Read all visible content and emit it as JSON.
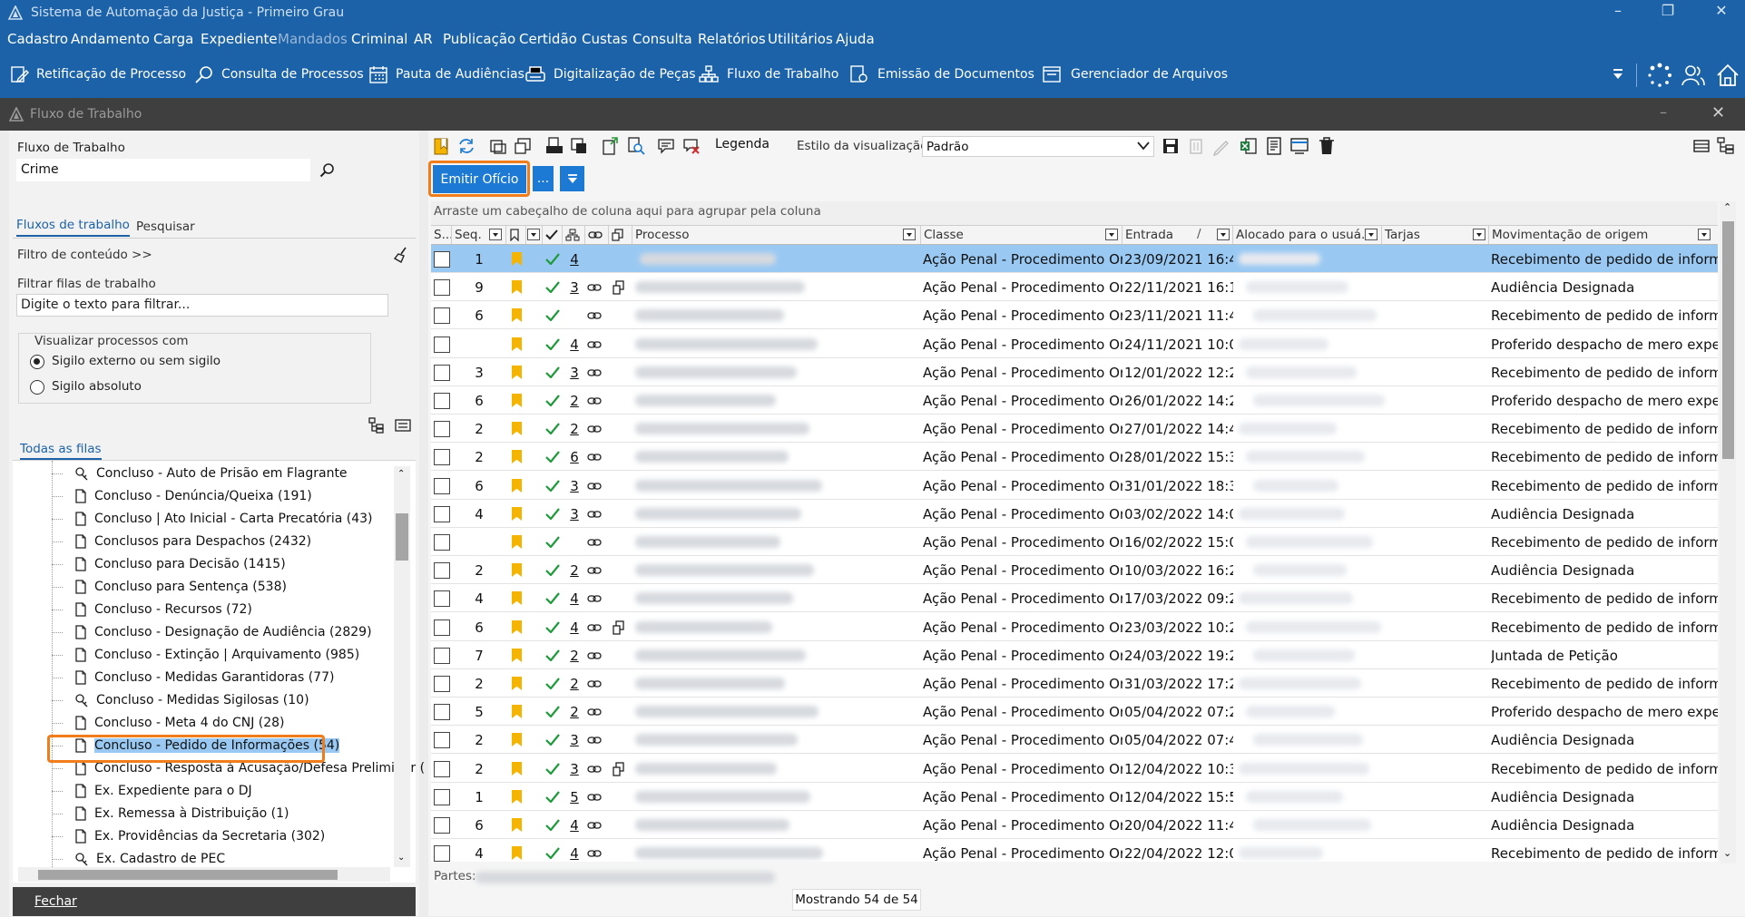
{
  "window": {
    "title": "Sistema de Automação da Justiça - Primeiro Grau"
  },
  "menu": [
    "Cadastro",
    "Andamento",
    "Carga",
    "Expediente",
    "Mandados",
    "Criminal",
    "AR",
    "Publicação",
    "Certidão",
    "Custas",
    "Consulta",
    "Relatórios",
    "Utilitários",
    "Ajuda"
  ],
  "toolbar": [
    "Retificação de Processo",
    "Consulta de Processos",
    "Pauta de Audiências",
    "Digitalização de Peças",
    "Fluxo de Trabalho",
    "Emissão de Documentos",
    "Gerenciador de Arquivos"
  ],
  "inner_window": {
    "title": "Fluxo de Trabalho"
  },
  "left": {
    "workflow_label": "Fluxo de Trabalho",
    "workflow_value": "Crime",
    "tabs": [
      "Fluxos de trabalho",
      "Pesquisar"
    ],
    "content_filter": "Filtro de conteúdo >>",
    "filter_queues_label": "Filtrar filas de trabalho",
    "filter_queues_placeholder": "Digite o texto para filtrar...",
    "view_group": "Visualizar processos com",
    "radio1": "Sigilo externo ou sem sigilo",
    "radio2": "Sigilo absoluto",
    "all_queues": "Todas as filas",
    "queues": [
      "Concluso - Auto de Prisão em Flagrante",
      "Concluso - Denúncia/Queixa (191)",
      "Concluso | Ato Inicial - Carta Precatória (43)",
      "Conclusos para Despachos (2432)",
      "Concluso para Decisão (1415)",
      "Concluso para Sentença (538)",
      "Concluso - Recursos (72)",
      "Concluso - Designação de Audiência (2829)",
      "Concluso - Extinção | Arquivamento (985)",
      "Concluso - Medidas Garantidoras (77)",
      "Concluso - Medidas Sigilosas (10)",
      "Concluso - Meta 4 do CNJ (28)",
      "Concluso - Pedido de Informações (54)",
      "Concluso - Resposta à Acusação/Defesa Preliminar (",
      "Ex. Expediente para o DJ",
      "Ex. Remessa à Distribuição (1)",
      "Ex. Providências da Secretaria (302)",
      "Ex. Cadastro de PEC"
    ],
    "close_label": "Fechar"
  },
  "grid": {
    "legend_label": "Legenda",
    "style_label": "Estilo da visualização",
    "style_value": "Padrão",
    "emit_button": "Emitir Ofício",
    "more_button": "...",
    "group_hint": "Arraste um cabeçalho de coluna aqui para agrupar pela coluna",
    "columns": [
      "S...",
      "Seq.",
      "Processo",
      "Classe",
      "Entrada",
      "Alocado para o usuá...",
      "Tarjas",
      "Movimentação de origem"
    ],
    "rows": [
      {
        "seq": "1",
        "n": "4",
        "link": false,
        "doc": false,
        "classe": "Ação Penal - Procedimento Ordi",
        "entrada": "23/09/2021 16:4",
        "mov": "Recebimento de pedido de inform"
      },
      {
        "seq": "9",
        "n": "3",
        "link": true,
        "doc": true,
        "classe": "Ação Penal - Procedimento Ordi",
        "entrada": "22/11/2021 16:1",
        "mov": "Audiência Designada"
      },
      {
        "seq": "6",
        "n": "",
        "link": true,
        "doc": false,
        "classe": "Ação Penal - Procedimento Ordi",
        "entrada": "23/11/2021 11:4",
        "mov": "Recebimento de pedido de inform"
      },
      {
        "seq": "",
        "n": "4",
        "link": true,
        "doc": false,
        "classe": "Ação Penal - Procedimento Ordi",
        "entrada": "24/11/2021 10:0",
        "mov": "Proferido despacho de mero expe"
      },
      {
        "seq": "3",
        "n": "3",
        "link": true,
        "doc": false,
        "classe": "Ação Penal - Procedimento Ordi",
        "entrada": "12/01/2022 12:2",
        "mov": "Recebimento de pedido de inform"
      },
      {
        "seq": "6",
        "n": "2",
        "link": true,
        "doc": false,
        "classe": "Ação Penal - Procedimento Ordi",
        "entrada": "26/01/2022 14:2",
        "mov": "Proferido despacho de mero expe"
      },
      {
        "seq": "2",
        "n": "2",
        "link": true,
        "doc": false,
        "classe": "Ação Penal - Procedimento Ordi",
        "entrada": "27/01/2022 14:4",
        "mov": "Recebimento de pedido de inform"
      },
      {
        "seq": "2",
        "n": "6",
        "link": true,
        "doc": false,
        "classe": "Ação Penal - Procedimento Ordi",
        "entrada": "28/01/2022 15:3",
        "mov": "Recebimento de pedido de inform"
      },
      {
        "seq": "6",
        "n": "3",
        "link": true,
        "doc": false,
        "classe": "Ação Penal - Procedimento Ordi",
        "entrada": "31/01/2022 18:3",
        "mov": "Recebimento de pedido de inform"
      },
      {
        "seq": "4",
        "n": "3",
        "link": true,
        "doc": false,
        "classe": "Ação Penal - Procedimento Ordi",
        "entrada": "03/02/2022 14:0",
        "mov": "Audiência Designada"
      },
      {
        "seq": "",
        "n": "",
        "link": true,
        "doc": false,
        "classe": "Ação Penal - Procedimento Ordi",
        "entrada": "16/02/2022 15:0",
        "mov": "Recebimento de pedido de inform"
      },
      {
        "seq": "2",
        "n": "2",
        "link": true,
        "doc": false,
        "classe": "Ação Penal - Procedimento Ordi",
        "entrada": "10/03/2022 16:2",
        "mov": "Audiência Designada"
      },
      {
        "seq": "4",
        "n": "4",
        "link": true,
        "doc": false,
        "classe": "Ação Penal - Procedimento Ordi",
        "entrada": "17/03/2022 09:2",
        "mov": "Recebimento de pedido de inform"
      },
      {
        "seq": "6",
        "n": "4",
        "link": true,
        "doc": true,
        "classe": "Ação Penal - Procedimento Ordi",
        "entrada": "23/03/2022 10:2",
        "mov": "Recebimento de pedido de inform"
      },
      {
        "seq": "7",
        "n": "2",
        "link": true,
        "doc": false,
        "classe": "Ação Penal - Procedimento Ordi",
        "entrada": "24/03/2022 19:2",
        "mov": "Juntada de Petição"
      },
      {
        "seq": "2",
        "n": "2",
        "link": true,
        "doc": false,
        "classe": "Ação Penal - Procedimento Ordi",
        "entrada": "31/03/2022 17:2",
        "mov": "Recebimento de pedido de inform"
      },
      {
        "seq": "5",
        "n": "2",
        "link": true,
        "doc": false,
        "classe": "Ação Penal - Procedimento Ordi",
        "entrada": "05/04/2022 07:2",
        "mov": "Proferido despacho de mero expe"
      },
      {
        "seq": "2",
        "n": "3",
        "link": true,
        "doc": false,
        "classe": "Ação Penal - Procedimento Ordi",
        "entrada": "05/04/2022 07:4",
        "mov": "Audiência Designada"
      },
      {
        "seq": "2",
        "n": "3",
        "link": true,
        "doc": true,
        "classe": "Ação Penal - Procedimento Ordi",
        "entrada": "12/04/2022 10:3",
        "mov": "Recebimento de pedido de inform"
      },
      {
        "seq": "1",
        "n": "5",
        "link": true,
        "doc": false,
        "classe": "Ação Penal - Procedimento Ordi",
        "entrada": "12/04/2022 15:5",
        "mov": "Audiência Designada"
      },
      {
        "seq": "6",
        "n": "4",
        "link": true,
        "doc": false,
        "classe": "Ação Penal - Procedimento Ordi",
        "entrada": "20/04/2022 11:4",
        "mov": "Audiência Designada"
      },
      {
        "seq": "4",
        "n": "4",
        "link": true,
        "doc": false,
        "classe": "Ação Penal - Procedimento Ordi",
        "entrada": "22/04/2022 12:0",
        "mov": "Recebimento de pedido de inform"
      }
    ],
    "parts_label": "Partes:",
    "showing": "Mostrando 54 de 54"
  }
}
